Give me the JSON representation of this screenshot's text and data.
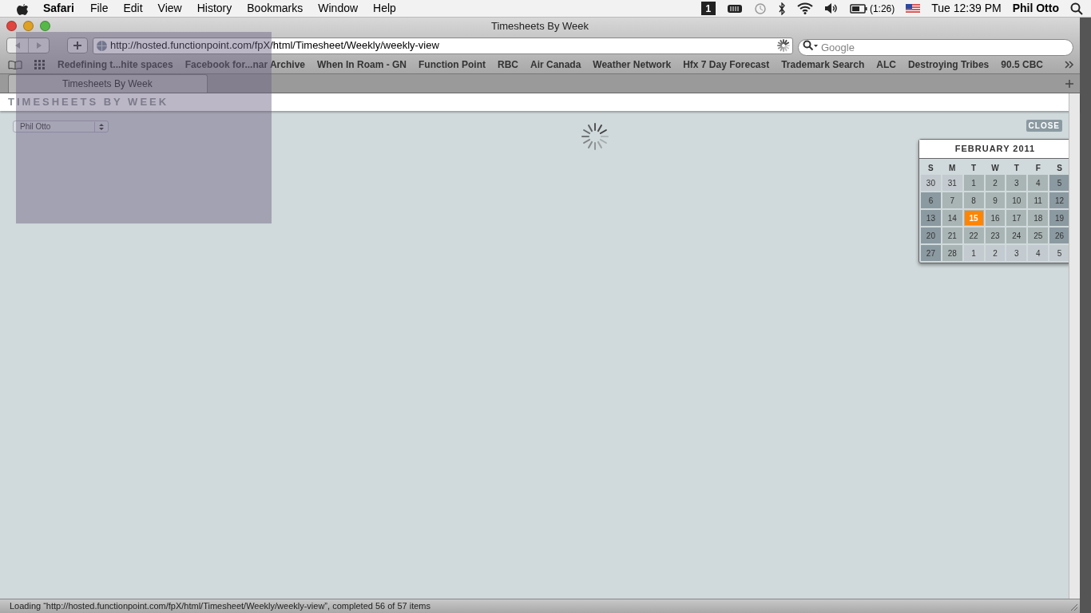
{
  "menu_bar": {
    "app": "Safari",
    "items": [
      "File",
      "Edit",
      "View",
      "History",
      "Bookmarks",
      "Window",
      "Help"
    ],
    "spaces": "1",
    "battery_time": "(1:26)",
    "clock": "Tue 12:39 PM",
    "user": "Phil Otto"
  },
  "window": {
    "title": "Timesheets By Week"
  },
  "toolbar": {
    "url": "http://hosted.functionpoint.com/fpX/html/Timesheet/Weekly/weekly-view",
    "search_placeholder": "Google"
  },
  "bookmarks": [
    "Redefining t...hite spaces",
    "Facebook for...nar Archive",
    "When In Roam - GN",
    "Function Point",
    "RBC",
    "Air Canada",
    "Weather Network",
    "Hfx 7 Day Forecast",
    "Trademark Search",
    "ALC",
    "Destroying Tribes",
    "90.5 CBC"
  ],
  "tabs": [
    {
      "label": "Timesheets By Week",
      "selected": true
    }
  ],
  "page": {
    "heading": "TIMESHEETS BY WEEK",
    "user_select": "Phil Otto",
    "close": "CLOSE"
  },
  "calendar": {
    "title": "FEBRUARY 2011",
    "weekdays": [
      "S",
      "M",
      "T",
      "W",
      "T",
      "F",
      "S"
    ],
    "days": [
      {
        "label": "30",
        "kind": "other",
        "selected": false
      },
      {
        "label": "31",
        "kind": "other",
        "selected": false
      },
      {
        "label": "1",
        "kind": "weekday",
        "selected": false
      },
      {
        "label": "2",
        "kind": "weekday",
        "selected": false
      },
      {
        "label": "3",
        "kind": "weekday",
        "selected": false
      },
      {
        "label": "4",
        "kind": "weekday",
        "selected": false
      },
      {
        "label": "5",
        "kind": "weekend",
        "selected": false
      },
      {
        "label": "6",
        "kind": "weekend",
        "selected": false
      },
      {
        "label": "7",
        "kind": "weekday",
        "selected": false
      },
      {
        "label": "8",
        "kind": "weekday",
        "selected": false
      },
      {
        "label": "9",
        "kind": "weekday",
        "selected": false
      },
      {
        "label": "10",
        "kind": "weekday",
        "selected": false
      },
      {
        "label": "11",
        "kind": "weekday",
        "selected": false
      },
      {
        "label": "12",
        "kind": "weekend",
        "selected": false
      },
      {
        "label": "13",
        "kind": "weekend",
        "selected": false
      },
      {
        "label": "14",
        "kind": "weekday",
        "selected": false
      },
      {
        "label": "15",
        "kind": "weekday",
        "selected": true
      },
      {
        "label": "16",
        "kind": "weekday",
        "selected": false
      },
      {
        "label": "17",
        "kind": "weekday",
        "selected": false
      },
      {
        "label": "18",
        "kind": "weekday",
        "selected": false
      },
      {
        "label": "19",
        "kind": "weekend",
        "selected": false
      },
      {
        "label": "20",
        "kind": "weekend",
        "selected": false
      },
      {
        "label": "21",
        "kind": "weekday",
        "selected": false
      },
      {
        "label": "22",
        "kind": "weekday",
        "selected": false
      },
      {
        "label": "23",
        "kind": "weekday",
        "selected": false
      },
      {
        "label": "24",
        "kind": "weekday",
        "selected": false
      },
      {
        "label": "25",
        "kind": "weekday",
        "selected": false
      },
      {
        "label": "26",
        "kind": "weekend",
        "selected": false
      },
      {
        "label": "27",
        "kind": "weekend",
        "selected": false
      },
      {
        "label": "28",
        "kind": "weekday",
        "selected": false
      },
      {
        "label": "1",
        "kind": "other",
        "selected": false
      },
      {
        "label": "2",
        "kind": "other",
        "selected": false
      },
      {
        "label": "3",
        "kind": "other",
        "selected": false
      },
      {
        "label": "4",
        "kind": "other",
        "selected": false
      },
      {
        "label": "5",
        "kind": "other",
        "selected": false
      }
    ]
  },
  "status_bar": "Loading “http://hosted.functionpoint.com/fpX/html/Timesheet/Weekly/weekly-view”, completed 56 of 57 items"
}
